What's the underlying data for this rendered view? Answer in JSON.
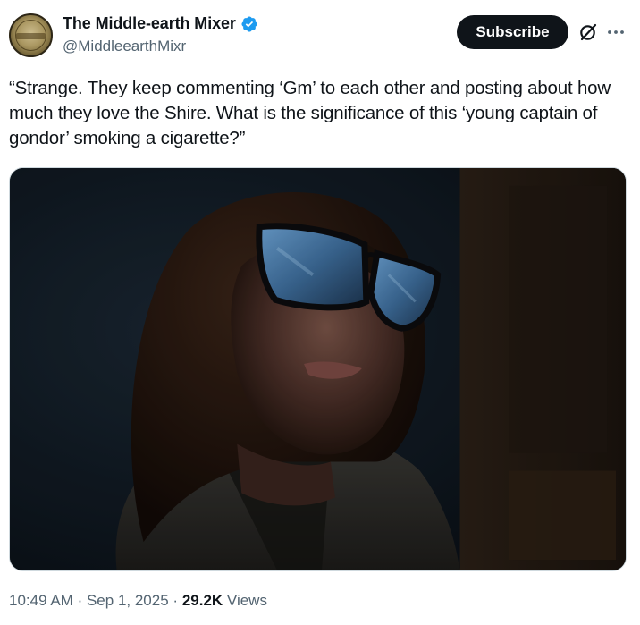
{
  "author": {
    "display_name": "The Middle-earth Mixer",
    "handle": "@MiddleearthMixr",
    "verified": true,
    "avatar_icon": "middle-earth-seal-avatar"
  },
  "actions": {
    "subscribe_label": "Subscribe",
    "grok_icon": "grok-icon",
    "more_icon": "more-icon"
  },
  "tweet": {
    "text": "“Strange. They keep commenting ‘Gm’ to each other and posting about how much they love the Shire. What is the significance of this ‘young captain of gondor’ smoking a cigarette?”"
  },
  "media": {
    "kind": "image",
    "subject": "woman-with-glasses-dark-scene"
  },
  "meta": {
    "time": "10:49 AM",
    "separator": "·",
    "date": "Sep 1, 2025",
    "views_count": "29.2K",
    "views_label": "Views"
  },
  "colors": {
    "text_primary": "#0f1419",
    "text_secondary": "#536471",
    "verified_blue": "#1d9bf0",
    "button_bg": "#0f1419"
  }
}
